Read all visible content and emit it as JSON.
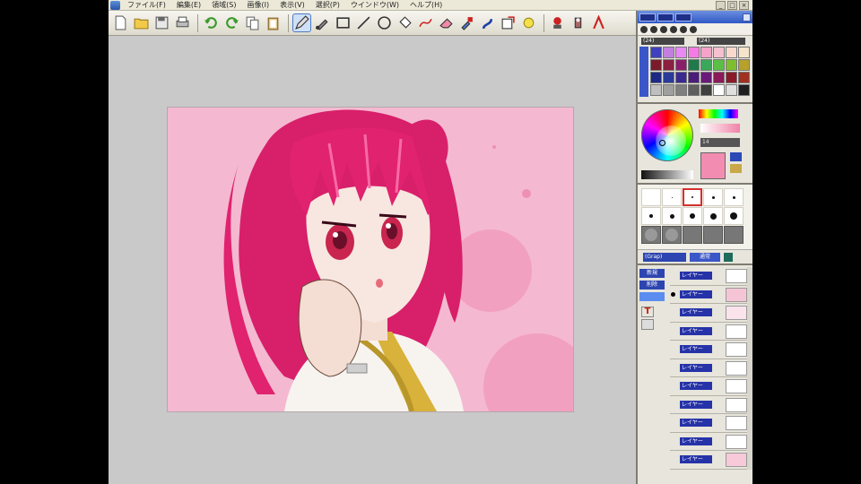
{
  "menu": {
    "items": [
      "ファイル(F)",
      "編集(E)",
      "領域(S)",
      "画像(I)",
      "表示(V)",
      "選択(P)",
      "ウインドウ(W)",
      "ヘルプ(H)"
    ]
  },
  "window_controls": {
    "minimize": "_",
    "maximize": "□",
    "close": "×"
  },
  "toolbar": {
    "tools": [
      "new-file-icon",
      "open-folder-icon",
      "save-icon",
      "print-icon",
      "undo-icon",
      "redo-icon",
      "copy-icon",
      "paste-icon",
      "pen-icon",
      "brush-icon",
      "rect-icon",
      "line-icon",
      "ellipse-icon",
      "bucket-icon",
      "bezier-icon",
      "eraser-icon",
      "dropper-icon",
      "smudge-icon",
      "transform-icon",
      "sparkle-icon",
      "stamp-icon",
      "blur-icon",
      "text-icon"
    ],
    "active_tool": "pen-icon"
  },
  "palette": {
    "preset_label": "(24)",
    "preset_label_2": "(24)",
    "swatches": [
      "#3f3fbf",
      "#c37fe0",
      "#e989f3",
      "#f57be4",
      "#f5a3c8",
      "#f5c0cf",
      "#f7d9ce",
      "#f7e4cc",
      "#7a1a2a",
      "#8b2040",
      "#8b1e6a",
      "#1e7a4a",
      "#3aa85a",
      "#5bbf45",
      "#7fbf2f",
      "#b7a12a",
      "#1c2a85",
      "#2a3a9a",
      "#3a2a90",
      "#4a1e7a",
      "#6b1a7a",
      "#8a1a5a",
      "#8a1a2a",
      "#a03020",
      "#bfbfbf",
      "#9f9f9f",
      "#7f7f7f",
      "#5f5f5f",
      "#3f3f3f",
      "#ffffff",
      "#dfdfdf",
      "#1f1f1f"
    ]
  },
  "color": {
    "current": "#f28db1",
    "value_label": "14"
  },
  "brush": {
    "preset_label": "(Grap)",
    "mode_label": "通常"
  },
  "layer_tools": [
    "新規",
    "削除",
    "",
    "T",
    ""
  ],
  "layers": [
    {
      "name": "レイヤー",
      "thumb": "#ffffff",
      "active": false
    },
    {
      "name": "レイヤー",
      "thumb": "#f5c5d6",
      "active": true
    },
    {
      "name": "レイヤー",
      "thumb": "#fbe3ec",
      "active": false
    },
    {
      "name": "レイヤー",
      "thumb": "#ffffff",
      "active": false
    },
    {
      "name": "レイヤー",
      "thumb": "#ffffff",
      "active": false
    },
    {
      "name": "レイヤー",
      "thumb": "#ffffff",
      "active": false
    },
    {
      "name": "レイヤー",
      "thumb": "#ffffff",
      "active": false
    },
    {
      "name": "レイヤー",
      "thumb": "#ffffff",
      "active": false
    },
    {
      "name": "レイヤー",
      "thumb": "#ffffff",
      "active": false
    },
    {
      "name": "レイヤー",
      "thumb": "#ffffff",
      "active": false
    },
    {
      "name": "レイヤー",
      "thumb": "#f7c9d9",
      "active": false
    }
  ],
  "canvas": {
    "background": "#f4b9d0",
    "bokeh": "#f19bbd",
    "hair": "#e0226f",
    "skin": "#f7e7e0"
  }
}
